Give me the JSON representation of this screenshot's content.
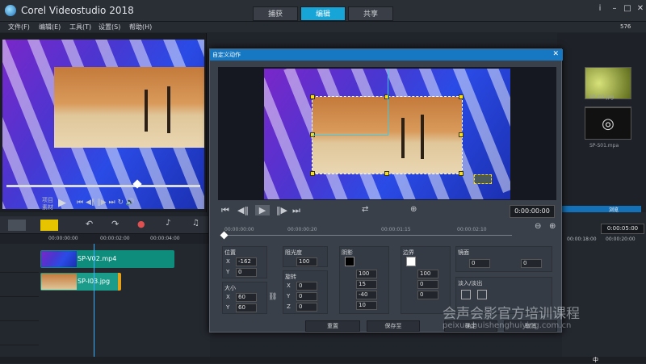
{
  "app": {
    "title": "Corel Videostudio 2018"
  },
  "steps": [
    {
      "label": "捕获"
    },
    {
      "label": "编辑"
    },
    {
      "label": "共享"
    }
  ],
  "menu": [
    {
      "label": "文件(F)"
    },
    {
      "label": "编辑(E)"
    },
    {
      "label": "工具(T)"
    },
    {
      "label": "设置(S)"
    },
    {
      "label": "帮助(H)"
    }
  ],
  "preview": {
    "labels": [
      "项目",
      "素材"
    ]
  },
  "library": {
    "top_right_text": "576",
    "thumbs": [
      {
        "label": "SP-I02.jpg"
      },
      {
        "label": "SP-S01.mpa"
      }
    ],
    "browse": "浏览"
  },
  "timeline": {
    "ruler": [
      "00:00:00:00",
      "00:00:02:00",
      "00:00:04:00"
    ],
    "clips": [
      {
        "name": "SP-V02.mp4"
      },
      {
        "name": "SP-I03.jpg"
      }
    ],
    "right_timecode": "0:00:05:00",
    "right_ruler": [
      "00:00:18:00",
      "00:00:20:00"
    ]
  },
  "dialog": {
    "title": "自定义动作",
    "timecode": "0:00:00:00",
    "ruler": [
      "00:00:00:00",
      "00:00:00:20",
      "00:00:01:15",
      "00:00:02:10"
    ],
    "position": {
      "label": "位置",
      "x": "-162",
      "y": "0"
    },
    "size": {
      "label": "大小",
      "x": "60",
      "y": "60"
    },
    "opacity": {
      "label": "阻光度",
      "value": "100"
    },
    "rotation": {
      "label": "旋转",
      "x": "0",
      "y": "0",
      "z": "0"
    },
    "shadow": {
      "label": "阴影",
      "values": [
        "100",
        "15",
        "-40",
        "10"
      ]
    },
    "border": {
      "label": "边界",
      "values": [
        "100",
        "0",
        "0"
      ]
    },
    "mirror": {
      "label": "镜面",
      "a": "0",
      "b": "0"
    },
    "fade": {
      "label": "淡入/淡出"
    },
    "buttons": {
      "reset": "重置",
      "save_as": "保存至",
      "ok": "确定",
      "cancel": "取消"
    }
  },
  "watermark": {
    "cn": "会声会影官方培训课程",
    "url": "peixun.huishenghuiying.com.cn"
  },
  "status": {
    "text": "中"
  }
}
